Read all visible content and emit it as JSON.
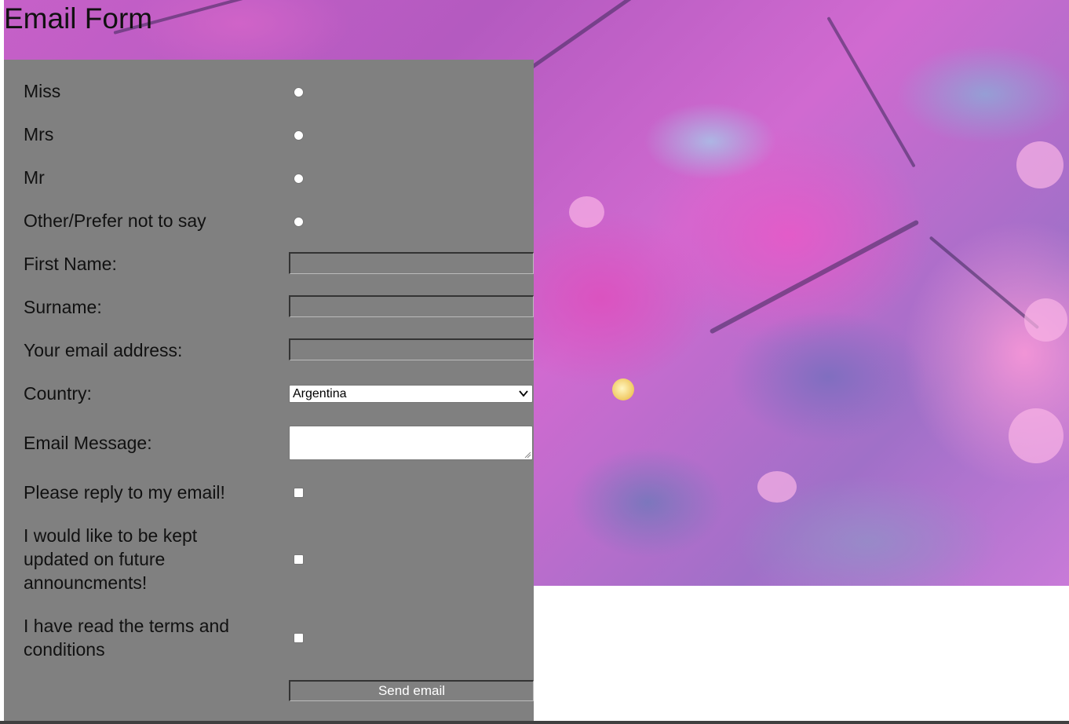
{
  "page": {
    "title": "Email Form"
  },
  "form": {
    "title_options": [
      {
        "label": "Miss",
        "selected": false
      },
      {
        "label": "Mrs",
        "selected": false
      },
      {
        "label": "Mr",
        "selected": false
      },
      {
        "label": "Other/Prefer not to say",
        "selected": false
      }
    ],
    "first_name": {
      "label": "First Name:",
      "value": ""
    },
    "surname": {
      "label": "Surname:",
      "value": ""
    },
    "email": {
      "label": "Your email address:",
      "value": ""
    },
    "country": {
      "label": "Country:",
      "selected": "Argentina"
    },
    "message": {
      "label": "Email Message:",
      "value": ""
    },
    "checkboxes": [
      {
        "label": "Please reply to my email!",
        "checked": false
      },
      {
        "label": "I would like to be kept updated on future announcments!",
        "checked": false
      },
      {
        "label": "I have read the terms and conditions",
        "checked": false
      }
    ],
    "submit_label": "Send email"
  },
  "colors": {
    "panel_background": "#808080",
    "page_background": "#ffffff",
    "text": "#111111"
  },
  "icons": {
    "select_chevron": "chevron-down-icon",
    "textarea_resize": "resize-grip-icon"
  }
}
